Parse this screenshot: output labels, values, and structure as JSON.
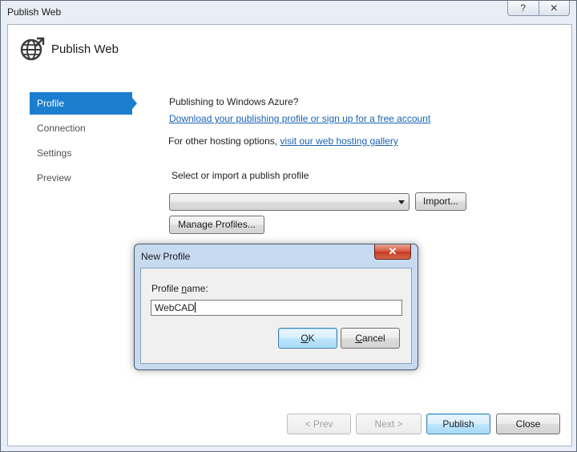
{
  "window": {
    "title": "Publish Web",
    "help_glyph": "?",
    "close_glyph": "✕"
  },
  "header": {
    "title": "Publish Web",
    "icon": "globe-publish-icon"
  },
  "nav": {
    "items": [
      {
        "label": "Profile",
        "active": true
      },
      {
        "label": "Connection",
        "active": false
      },
      {
        "label": "Settings",
        "active": false
      },
      {
        "label": "Preview",
        "active": false
      }
    ]
  },
  "profile_page": {
    "azure_heading": "Publishing to Windows Azure?",
    "azure_link": "Download your publishing profile or sign up for a free account",
    "hosting_prefix": "For other hosting options,",
    "hosting_link": "visit our web hosting gallery",
    "select_label": "Select or import a publish profile",
    "profile_combo_value": "",
    "import_button": "Import...",
    "manage_button": "Manage Profiles..."
  },
  "footer": {
    "prev_button": "< Prev",
    "next_button": "Next >",
    "publish_button": "Publish",
    "close_button": "Close"
  },
  "dialog": {
    "title": "New Profile",
    "close_glyph": "✕",
    "label_pre": "Profile ",
    "label_mnemonic": "n",
    "label_post": "ame:",
    "input_value": "WebCAD",
    "ok_mnemonic": "O",
    "ok_rest": "K",
    "cancel_mnemonic": "C",
    "cancel_rest": "ancel"
  },
  "colors": {
    "accent": "#1c7ecf",
    "link": "#1a62b4"
  }
}
